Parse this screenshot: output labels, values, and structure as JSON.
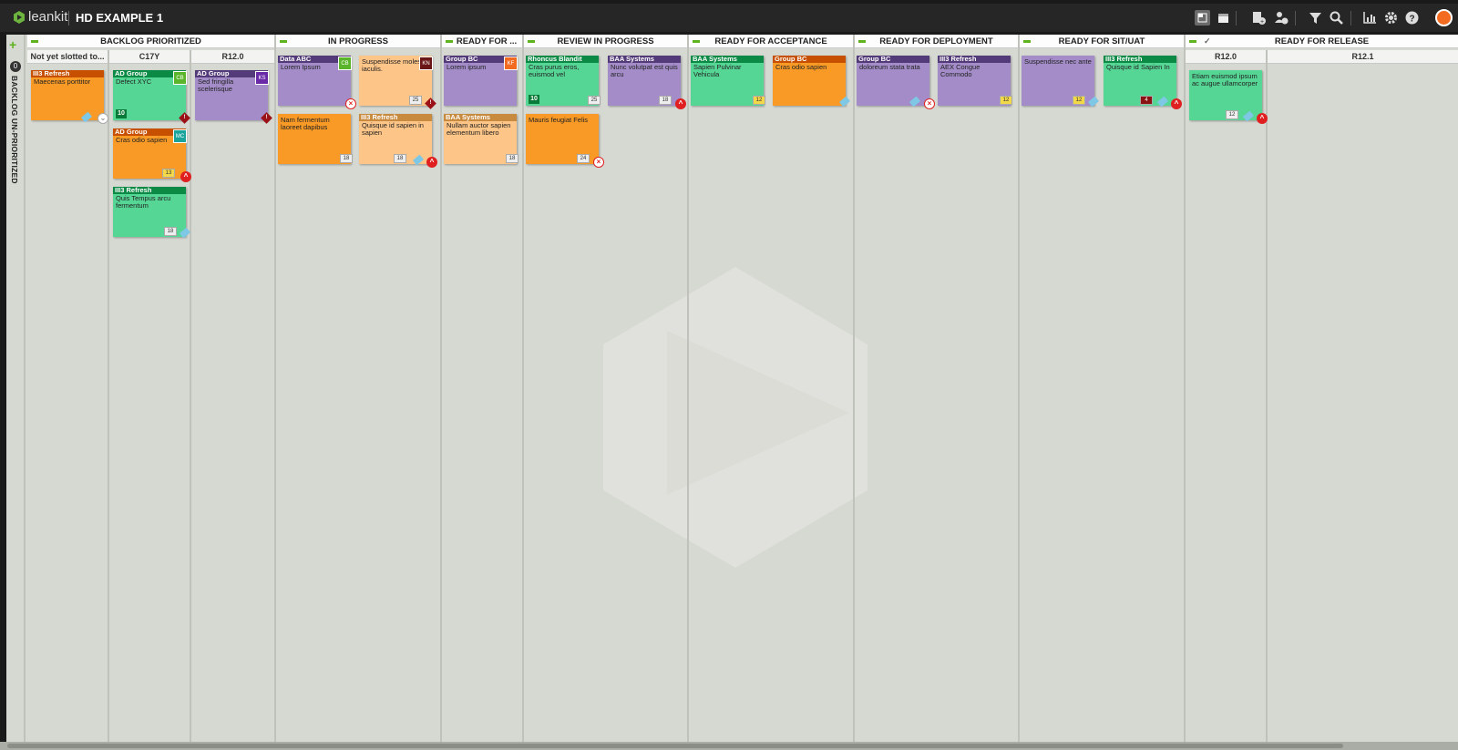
{
  "app": {
    "logo": "leankit",
    "board_title": "HD EXAMPLE 1"
  },
  "toolbar": {
    "icons": [
      "board-view-icon",
      "calendar-view-icon",
      "add-card-icon",
      "add-user-icon",
      "filter-icon",
      "search-icon",
      "analytics-icon",
      "settings-icon",
      "help-icon",
      "avatar-icon"
    ],
    "accent": "#f26b21"
  },
  "unprioritized": {
    "count": "0",
    "label": "BACKLOG UN-PRIORITIZED"
  },
  "lanes": [
    {
      "title": "BACKLOG PRIORITIZED",
      "sub": [
        "Not yet slotted to...",
        "C17Y",
        "R12.0"
      ]
    },
    {
      "title": "IN PROGRESS"
    },
    {
      "title": "READY FOR ..."
    },
    {
      "title": "REVIEW IN PROGRESS"
    },
    {
      "title": "READY FOR ACCEPTANCE"
    },
    {
      "title": "READY FOR DEPLOYMENT"
    },
    {
      "title": "READY FOR SIT/UAT"
    },
    {
      "title": "READY FOR RELEASE",
      "sub": [
        "R12.0",
        "R12.1"
      ]
    }
  ],
  "cards": [
    {
      "hd": "III3 Refresh",
      "tx": "Maecenas porttitor"
    },
    {
      "hd": "AD Group",
      "tx": "Defect XYC",
      "av": "CB",
      "num": "10"
    },
    {
      "hd": "AD Group",
      "tx": "Cras odio sapien",
      "av": "MC",
      "cal": "13"
    },
    {
      "hd": "III3 Refresh",
      "tx": "Quis Tempus arcu fermentum",
      "cal": "18"
    },
    {
      "hd": "AD Group",
      "tx": "Sed fringilla scelerisque",
      "av": "KS"
    },
    {
      "hd": "Data ABC",
      "tx": "Lorem Ipsum",
      "av": "CB"
    },
    {
      "hd": "",
      "tx": "Suspendisse molestie iaculis.",
      "av": "KN",
      "cal": "25"
    },
    {
      "hd": "",
      "tx": "Nam fermentum laoreet dapibus",
      "cal": "18"
    },
    {
      "hd": "III3 Refresh",
      "tx": "Quisque id sapien in sapien",
      "cal": "18"
    },
    {
      "hd": "Group BC",
      "tx": "Lorem ipsum",
      "av": "KF"
    },
    {
      "hd": "BAA Systems",
      "tx": "Nullam auctor sapien elementum libero",
      "cal": "18"
    },
    {
      "hd": "Rhoncus Blandit",
      "tx": "Cras purus eros, euismod vel",
      "num": "10",
      "cal": "25"
    },
    {
      "hd": "BAA Systems",
      "tx": "Nunc volutpat est quis arcu",
      "cal": "18"
    },
    {
      "hd": "",
      "tx": "Mauris feugiat Felis",
      "cal": "24"
    },
    {
      "hd": "BAA Systems",
      "tx": "Sapien Pulvinar Vehicula",
      "cal": "12"
    },
    {
      "hd": "Group BC",
      "tx": "Cras odio sapien"
    },
    {
      "hd": "Group BC",
      "tx": "doloreum stata trata"
    },
    {
      "hd": "III3 Refresh",
      "tx": "AEX Congue Commodo",
      "cal": "12"
    },
    {
      "hd": "",
      "tx": "Suspendisse nec ante",
      "cal": "12"
    },
    {
      "hd": "III3 Refresh",
      "tx": "Quisque id Sapien In",
      "cal": "4"
    },
    {
      "hd": "",
      "tx": "Etiam euismod ipsum ac augue ullamcorper",
      "cal": "12"
    }
  ]
}
